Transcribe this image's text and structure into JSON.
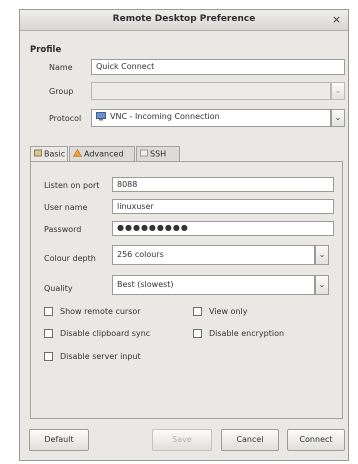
{
  "window": {
    "title": "Remote Desktop Preference",
    "close_glyph": "×"
  },
  "profile": {
    "section_title": "Profile",
    "name_label": "Name",
    "name_value": "Quick Connect",
    "group_label": "Group",
    "group_value": "",
    "protocol_label": "Protocol",
    "protocol_value": "VNC - Incoming Connection"
  },
  "tabs": [
    {
      "label": "Basic",
      "icon": "basic-icon"
    },
    {
      "label": "Advanced",
      "icon": "warning-icon"
    },
    {
      "label": "SSH",
      "icon": "ssh-icon"
    }
  ],
  "basic": {
    "listen_port_label": "Listen on port",
    "listen_port_value": "8088",
    "user_name_label": "User name",
    "user_name_value": "linuxuser",
    "password_label": "Password",
    "password_value": "●●●●●●●●●",
    "colour_depth_label": "Colour depth",
    "colour_depth_value": "256 colours",
    "quality_label": "Quality",
    "quality_value": "Best (slowest)",
    "checkboxes": {
      "show_remote_cursor": "Show remote cursor",
      "view_only": "View only",
      "disable_clipboard_sync": "Disable clipboard sync",
      "disable_encryption": "Disable encryption",
      "disable_server_input": "Disable server input"
    }
  },
  "buttons": {
    "default": "Default",
    "save": "Save",
    "cancel": "Cancel",
    "connect": "Connect"
  },
  "colors": {
    "window_bg": "#e9e8e4",
    "border": "#9d9b95"
  }
}
